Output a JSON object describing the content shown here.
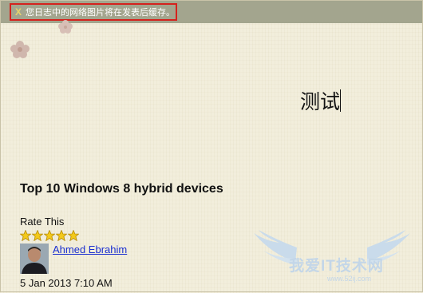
{
  "notice": {
    "close_glyph": "X",
    "message": "您日志中的网络图片将在发表后缓存。"
  },
  "editor": {
    "content": "测试"
  },
  "post": {
    "title": "Top 10 Windows 8 hybrid devices",
    "rate_label": "Rate This",
    "rating": 5,
    "rating_max": 5,
    "author": "Ahmed Ebrahim",
    "date": "5 Jan 2013 7:10 AM"
  },
  "watermark": {
    "text": "我爱IT技术网",
    "url": "www.52ij.com"
  },
  "colors": {
    "background": "#f2eedc",
    "notice_bar": "#a3a58e",
    "highlight_border": "#d5221d",
    "link": "#1a2fd0",
    "star": "#f3c91a"
  }
}
